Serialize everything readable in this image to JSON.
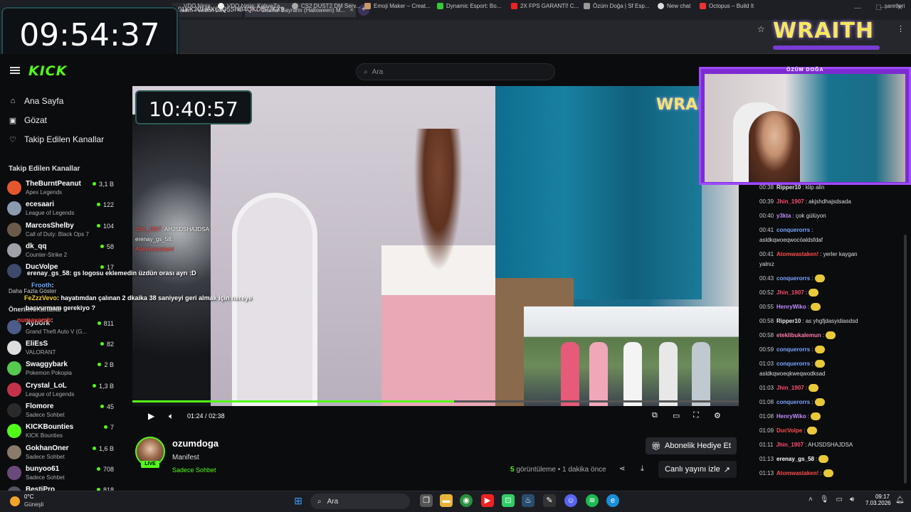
{
  "browser": {
    "tabs": [
      {
        "label": "...earn - Watch Live ..."
      },
      {
        "label": "Cadılar Bayramı (Halloween) M..."
      }
    ],
    "url": "01KK3CHAX6JQ5SHB4QKD5PJKX9",
    "bookmarks": [
      "VDO.Ninja",
      "VDO.Ninja: KahveZa...",
      "CS2 DUST2 DM Serv...",
      "Emoji Maker – Creat...",
      "Dynamic Esport: Bo...",
      "2X FPS GARANTİ! C...",
      "Özüm Doğa | Sf Esp...",
      "New chat",
      "Octopus – Build It"
    ],
    "bookmarks_more": "...şaretleri"
  },
  "overlay_clock": "09:54:37",
  "header": {
    "search_placeholder": "Ara"
  },
  "sidebar": {
    "nav": [
      {
        "label": "Ana Sayfa",
        "icon": "home-icon"
      },
      {
        "label": "Gözat",
        "icon": "browse-icon"
      },
      {
        "label": "Takip Edilen Kanallar",
        "icon": "heart-icon"
      }
    ],
    "following_header": "Takip Edilen Kanallar",
    "channels": [
      {
        "name": "TheBurntPeanut",
        "game": "Apex Legends",
        "viewers": "3,1 B",
        "color": "#e4572e"
      },
      {
        "name": "ecesaari",
        "game": "League of Legends",
        "viewers": "122",
        "color": "#8a9bb0"
      },
      {
        "name": "MarcosShelby",
        "game": "Call of Duty: Black Ops 7",
        "viewers": "104",
        "color": "#6b5a4a"
      },
      {
        "name": "dk_qq",
        "game": "Counter-Strike 2",
        "viewers": "58",
        "color": "#a0a0a8"
      },
      {
        "name": "DucVolpe",
        "game": "",
        "viewers": "17",
        "color": "#3d4a6b"
      },
      {
        "name": "Aybörk",
        "game": "Grand Theft Auto V (G...",
        "viewers": "811",
        "color": "#4b5d8a"
      },
      {
        "name": "EliEsS",
        "game": "VALORANT",
        "viewers": "82",
        "color": "#ddd"
      },
      {
        "name": "Swaggybark",
        "game": "Pokemon Pokopia",
        "viewers": "2 B",
        "color": "#56c94e"
      },
      {
        "name": "Crystal_LoL",
        "game": "League of Legends",
        "viewers": "1,3 B",
        "color": "#c4324a"
      },
      {
        "name": "Flomore",
        "game": "Sadece Sohbet",
        "viewers": "45",
        "color": "#2a2a2a"
      },
      {
        "name": "KICKBounties",
        "game": "KICK Bounties",
        "viewers": "7",
        "color": "#53fc18"
      },
      {
        "name": "GokhanOner",
        "game": "Sadece Sohbet",
        "viewers": "1,6 B",
        "color": "#8a7a6a"
      },
      {
        "name": "bunyoo61",
        "game": "Sadece Sohbet",
        "viewers": "708",
        "color": "#6a4a7a"
      },
      {
        "name": "BestiPro",
        "game": "",
        "viewers": "818",
        "color": "#556"
      }
    ],
    "show_more": "Daha Fazla Göster",
    "recommended_header": "Önerilen Kanallar"
  },
  "video": {
    "clock": "10:40:57",
    "brand_small": "WRAI",
    "current_time": "01:24",
    "separator": "/",
    "duration": "02:38",
    "progress": 0.53,
    "overlay_chat_small": [
      {
        "user": "Jhin_1907",
        "text": ": AHJSDSHAJDSA",
        "color": "#ff4d4d"
      },
      {
        "user": "erenay_gs_58",
        "text": ":",
        "color": "#ffffff"
      },
      {
        "user": "Atomwastaken!",
        "text": ":",
        "color": "#ff4d4d"
      }
    ],
    "overlay_chat_big": [
      {
        "user": "erenay_gs_58",
        "text": ": gs logosu eklemedin üzdün orası ayrı :D",
        "color": "#ffffff"
      },
      {
        "user": "Frooth",
        "text": ":",
        "color": "#6aa9ff"
      },
      {
        "user": "FeZzzVevo",
        "text": ": hayatımdan çalınan 2 dkaika 38 saniyeyi geri almak için nereye",
        "color": "#f5d02a"
      },
      {
        "user": "",
        "text": "başvurmam gerekiyo ?",
        "color": "#ffffff"
      },
      {
        "user": "numayamb",
        "text": ":",
        "color": "#ff4d4d"
      }
    ]
  },
  "stream": {
    "channel_name": "ozumdoga",
    "live_badge": "LIVE",
    "title": "Manifest",
    "category": "Sadece Sohbet",
    "subscribe_gift": "Abonelik Hediye Et",
    "views_count": "5",
    "views_label": "görüntüleme",
    "time_ago": "• 1 dakika önce",
    "watch_live": "Canlı yayını izle"
  },
  "webcam": {
    "label": "ÖZÜM DOĞA",
    "brand": "WRAITH"
  },
  "chat": [
    {
      "time": "00:38",
      "user": "Ripper10",
      "text": ": klip alin",
      "color": "#e8e8e8"
    },
    {
      "time": "00:39",
      "user": "Jhin_1907",
      "text": ": akjshdhajsdsada",
      "color": "#ff4d6d"
    },
    {
      "time": "00:40",
      "user": "y3kta",
      "text": ": çok gülüyon",
      "color": "#c08cff"
    },
    {
      "time": "00:41",
      "user": "conquerorrs",
      "text": ":",
      "color": "#7aa6ff"
    },
    {
      "time": "",
      "user": "",
      "text": "asldkqwoeqwocöaldsfdaf",
      "color": "#ddd"
    },
    {
      "time": "00:41",
      "user": "Atomwastaken!",
      "text": ": yerler kaygan",
      "color": "#ff4d4d"
    },
    {
      "time": "",
      "user": "",
      "text": "yalnız",
      "color": "#ddd"
    },
    {
      "time": "00:43",
      "user": "conquerorrs",
      "text": ":",
      "color": "#7aa6ff"
    },
    {
      "time": "00:52",
      "user": "Jhin_1907",
      "text": ":",
      "color": "#ff4d6d"
    },
    {
      "time": "00:55",
      "user": "HenryWiko",
      "text": ":",
      "color": "#c08cff"
    },
    {
      "time": "00:58",
      "user": "Ripper10",
      "text": ": as yhgfjdasyidiasdsd",
      "color": "#e8e8e8"
    },
    {
      "time": "00:58",
      "user": "eteklibukalemun",
      "text": ":",
      "color": "#ff7aa8"
    },
    {
      "time": "00:59",
      "user": "conquerorrs",
      "text": ":",
      "color": "#7aa6ff"
    },
    {
      "time": "01:03",
      "user": "conquerorrs",
      "text": ":",
      "color": "#7aa6ff"
    },
    {
      "time": "",
      "user": "",
      "text": "asldkqwoeqkweqwodksad",
      "color": "#ddd"
    },
    {
      "time": "01:03",
      "user": "Jhin_1907",
      "text": ":",
      "color": "#ff4d6d"
    },
    {
      "time": "01:08",
      "user": "conquerorrs",
      "text": ":",
      "color": "#7aa6ff"
    },
    {
      "time": "01:08",
      "user": "HenryWiko",
      "text": ":",
      "color": "#c08cff"
    },
    {
      "time": "01:09",
      "user": "DucVolpe",
      "text": ":",
      "color": "#ff4d4d"
    },
    {
      "time": "01:11",
      "user": "Jhin_1907",
      "text": ": AHJSDSHAJDSA",
      "color": "#ff4d6d"
    },
    {
      "time": "01:13",
      "user": "erenay_gs_58",
      "text": ":",
      "color": "#ffffff"
    },
    {
      "time": "01:13",
      "user": "Atomwastaken!",
      "text": ":",
      "color": "#ff4d4d"
    }
  ],
  "taskbar": {
    "weather_temp": "0°C",
    "weather_desc": "Güneşli",
    "search_label": "Ara",
    "time": "09:17",
    "date": "7.03.2026"
  }
}
